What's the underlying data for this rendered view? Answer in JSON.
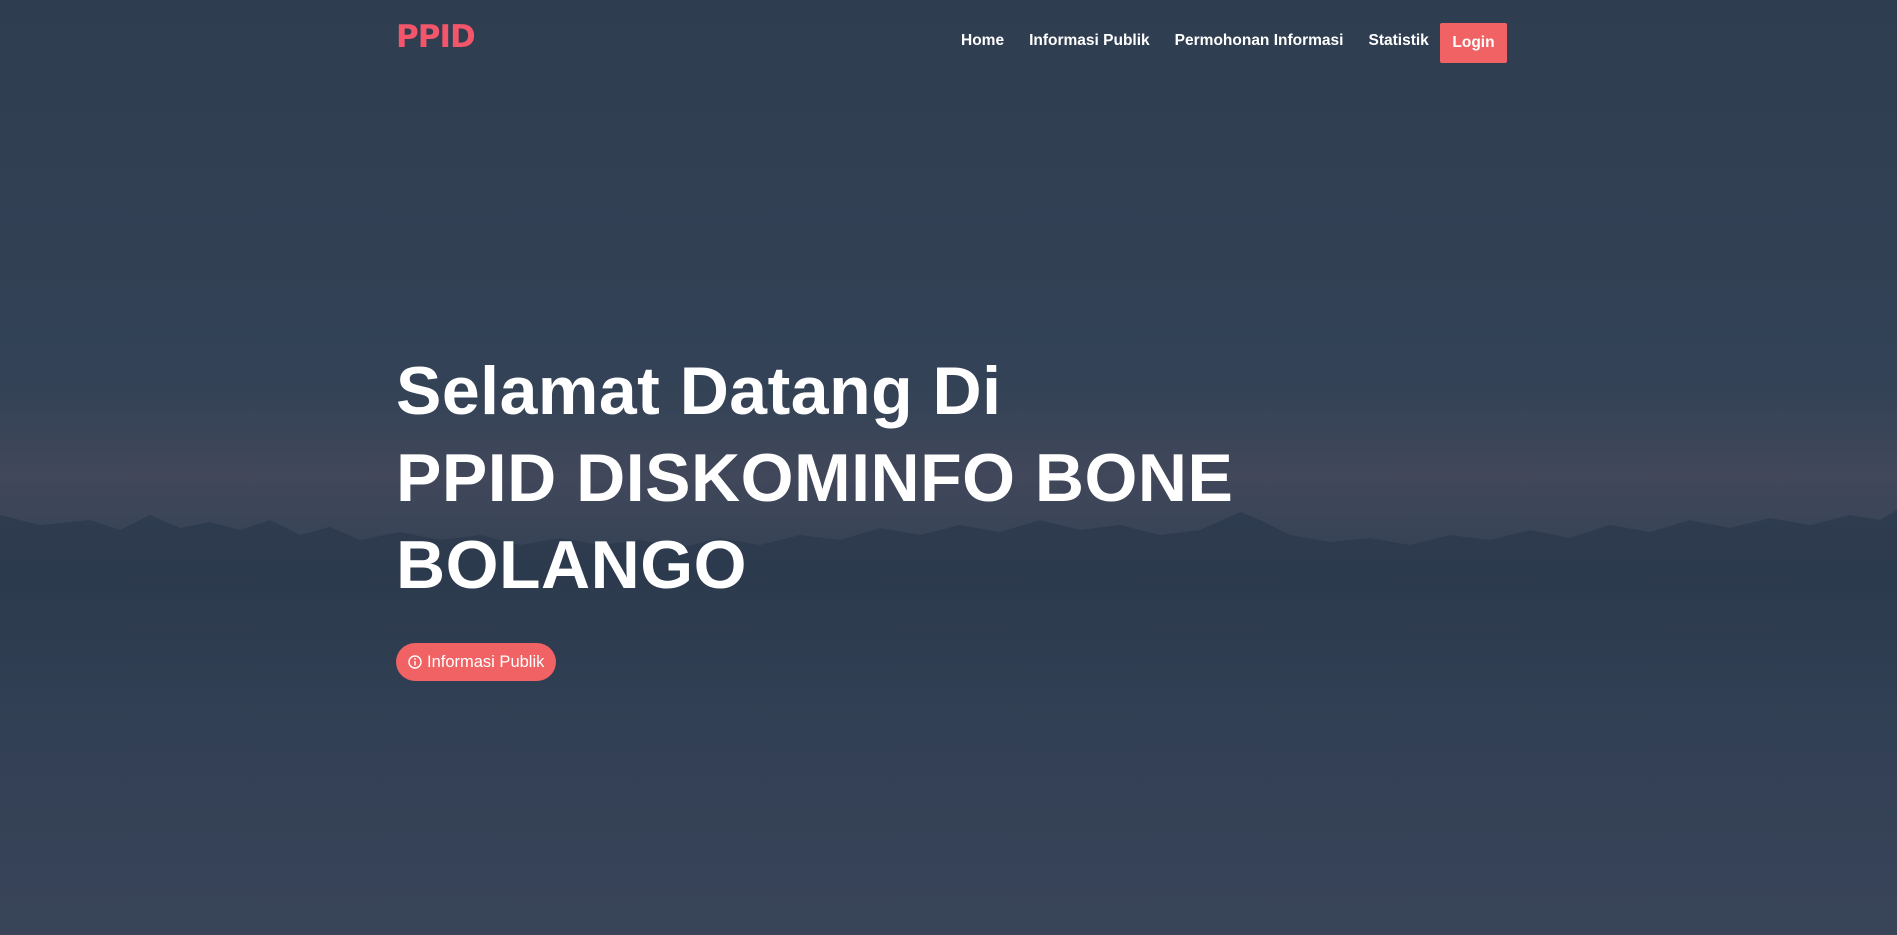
{
  "navbar": {
    "logo_text": "PPID",
    "links": [
      {
        "label": "Home"
      },
      {
        "label": "Informasi Publik"
      },
      {
        "label": "Permohonan Informasi"
      },
      {
        "label": "Statistik"
      }
    ],
    "login_label": "Login"
  },
  "hero": {
    "title_line1": "Selamat Datang Di",
    "title_line2": "PPID DISKOMINFO BONE",
    "title_line3": "BOLANGO",
    "button_label": "Informasi Publik",
    "button_icon": "info-circle-icon"
  },
  "colors": {
    "accent": "#f06263",
    "logo": "#f3556a",
    "background": "#334256"
  }
}
